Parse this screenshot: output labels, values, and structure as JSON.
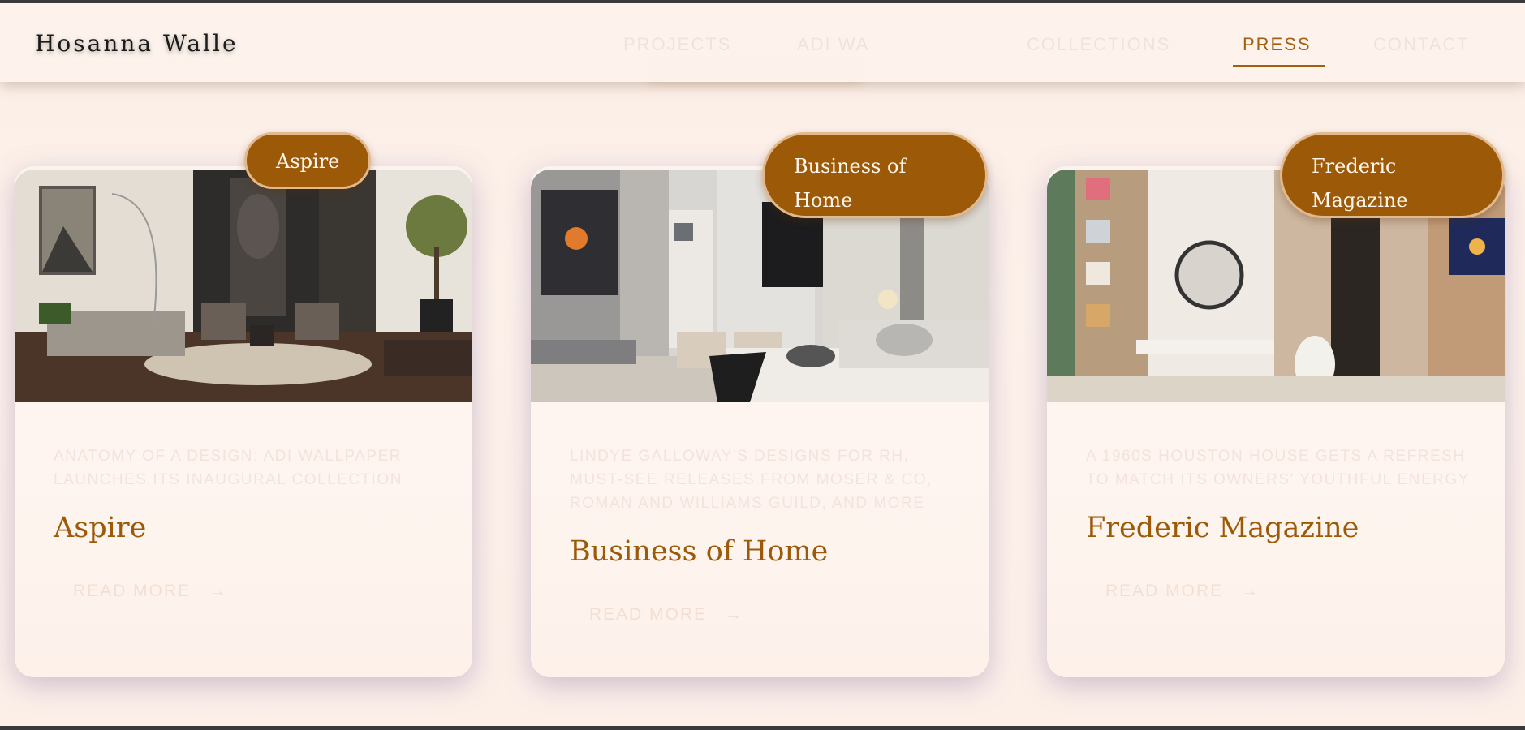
{
  "header": {
    "brand": "Hosanna Walle",
    "nav": [
      {
        "label": "PROJECTS"
      },
      {
        "label": "ADI WA"
      },
      {
        "label": "COLLECTIONS"
      },
      {
        "label": "PRESS"
      },
      {
        "label": "CONTACT"
      }
    ],
    "active": "PRESS"
  },
  "cards": [
    {
      "badge": "Aspire",
      "desc": "ANATOMY OF A DESIGN: ADI WALLPAPER LAUNCHES ITS INAUGURAL COLLECTION",
      "title": "Aspire",
      "more": "READ MORE",
      "arrow": "→"
    },
    {
      "badge": "Business of Home",
      "desc": "LINDYE GALLOWAY'S DESIGNS FOR RH, MUST-SEE RELEASES FROM MOSER & CO, ROMAN AND WILLIAMS GUILD, AND MORE",
      "title": "Business of Home",
      "more": "READ MORE",
      "arrow": "→"
    },
    {
      "badge": "Frederic Magazine",
      "desc": "A 1960S HOUSTON HOUSE GETS A REFRESH TO MATCH ITS OWNERS' YOUTHFUL ENERGY",
      "title": "Frederic Magazine",
      "more": "READ MORE",
      "arrow": "→"
    }
  ],
  "colors": {
    "accent": "#9c5a09",
    "badge_border": "#e2b98c",
    "background": "#fceee6"
  }
}
